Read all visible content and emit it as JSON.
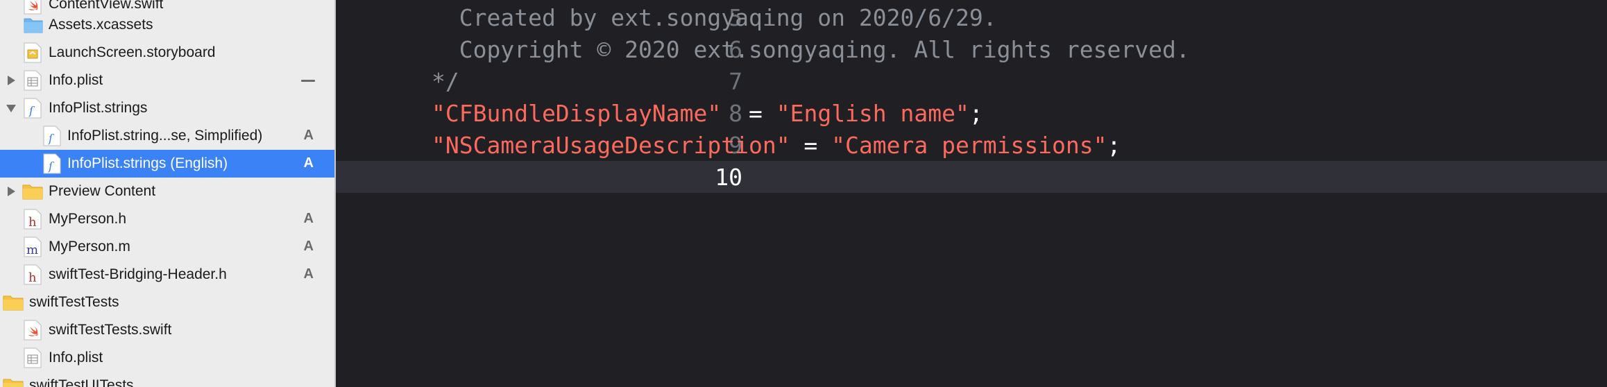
{
  "navigator": {
    "items": [
      {
        "name": "file-contentview-swift",
        "label": "ContentView.swift",
        "badge": "",
        "disclosure": "none",
        "icon": "swift-icon",
        "indent": 1
      },
      {
        "name": "file-assets-xcassets",
        "label": "Assets.xcassets",
        "badge": "",
        "disclosure": "none",
        "icon": "folder-blue-icon",
        "indent": 1
      },
      {
        "name": "file-launchscreen-storyboard",
        "label": "LaunchScreen.storyboard",
        "badge": "",
        "disclosure": "none",
        "icon": "storyboard-icon",
        "indent": 1
      },
      {
        "name": "file-info-plist",
        "label": "Info.plist",
        "badge": "",
        "disclosure": "collapsed",
        "icon": "plist-icon",
        "indent": 1
      },
      {
        "name": "file-infoplist-strings",
        "label": "InfoPlist.strings",
        "badge": "",
        "disclosure": "expanded",
        "icon": "strings-icon",
        "indent": 1
      },
      {
        "name": "file-infoplist-strings-chinese",
        "label": "InfoPlist.string...se, Simplified)",
        "badge": "A",
        "disclosure": "none",
        "icon": "strings-icon",
        "indent": 2
      },
      {
        "name": "file-infoplist-strings-english",
        "label": "InfoPlist.strings (English)",
        "badge": "A",
        "disclosure": "none",
        "icon": "strings-icon",
        "indent": 2
      },
      {
        "name": "folder-preview-content",
        "label": "Preview Content",
        "badge": "",
        "disclosure": "collapsed",
        "icon": "folder-icon",
        "indent": 1
      },
      {
        "name": "file-myperson-h",
        "label": "MyPerson.h",
        "badge": "A",
        "disclosure": "none",
        "icon": "header-h-icon",
        "indent": 1
      },
      {
        "name": "file-myperson-m",
        "label": "MyPerson.m",
        "badge": "A",
        "disclosure": "none",
        "icon": "source-m-icon",
        "indent": 1
      },
      {
        "name": "file-bridging-header",
        "label": "swiftTest-Bridging-Header.h",
        "badge": "A",
        "disclosure": "none",
        "icon": "header-h-icon",
        "indent": 1
      },
      {
        "name": "folder-swifttesttests",
        "label": "swiftTestTests",
        "badge": "",
        "disclosure": "none",
        "icon": "folder-icon",
        "indent": 0
      },
      {
        "name": "file-swifttesttests-swift",
        "label": "swiftTestTests.swift",
        "badge": "",
        "disclosure": "none",
        "icon": "swift-icon",
        "indent": 1
      },
      {
        "name": "file-tests-info-plist",
        "label": "Info.plist",
        "badge": "",
        "disclosure": "none",
        "icon": "plist-icon",
        "indent": 1
      },
      {
        "name": "folder-swifttestuitests",
        "label": "swiftTestUITests",
        "badge": "",
        "disclosure": "none",
        "icon": "folder-icon",
        "indent": 0
      }
    ],
    "selected_index": 6
  },
  "editor": {
    "current_line": "10",
    "lines": [
      {
        "num": "5",
        "comment": "  Created by ext.songyaqing on 2020/6/29."
      },
      {
        "num": "6",
        "comment": "  Copyright © 2020 ext.songyaqing. All rights reserved."
      },
      {
        "num": "7",
        "comment": "*/"
      },
      {
        "num": "8",
        "key": "\"CFBundleDisplayName\"",
        "eq": "  = ",
        "value": "\"English name\"",
        "semi": ";"
      },
      {
        "num": "9",
        "key": "\"NSCameraUsageDescription\"",
        "eq": " = ",
        "value": "\"Camera permissions\"",
        "semi": ";"
      },
      {
        "num": "10"
      }
    ]
  },
  "colors": {
    "selection": "#3b82f6",
    "string": "#fc6a5d",
    "comment": "#8a8f98",
    "editor_bg": "#1f1f24",
    "current_line_bg": "#2f3038"
  }
}
